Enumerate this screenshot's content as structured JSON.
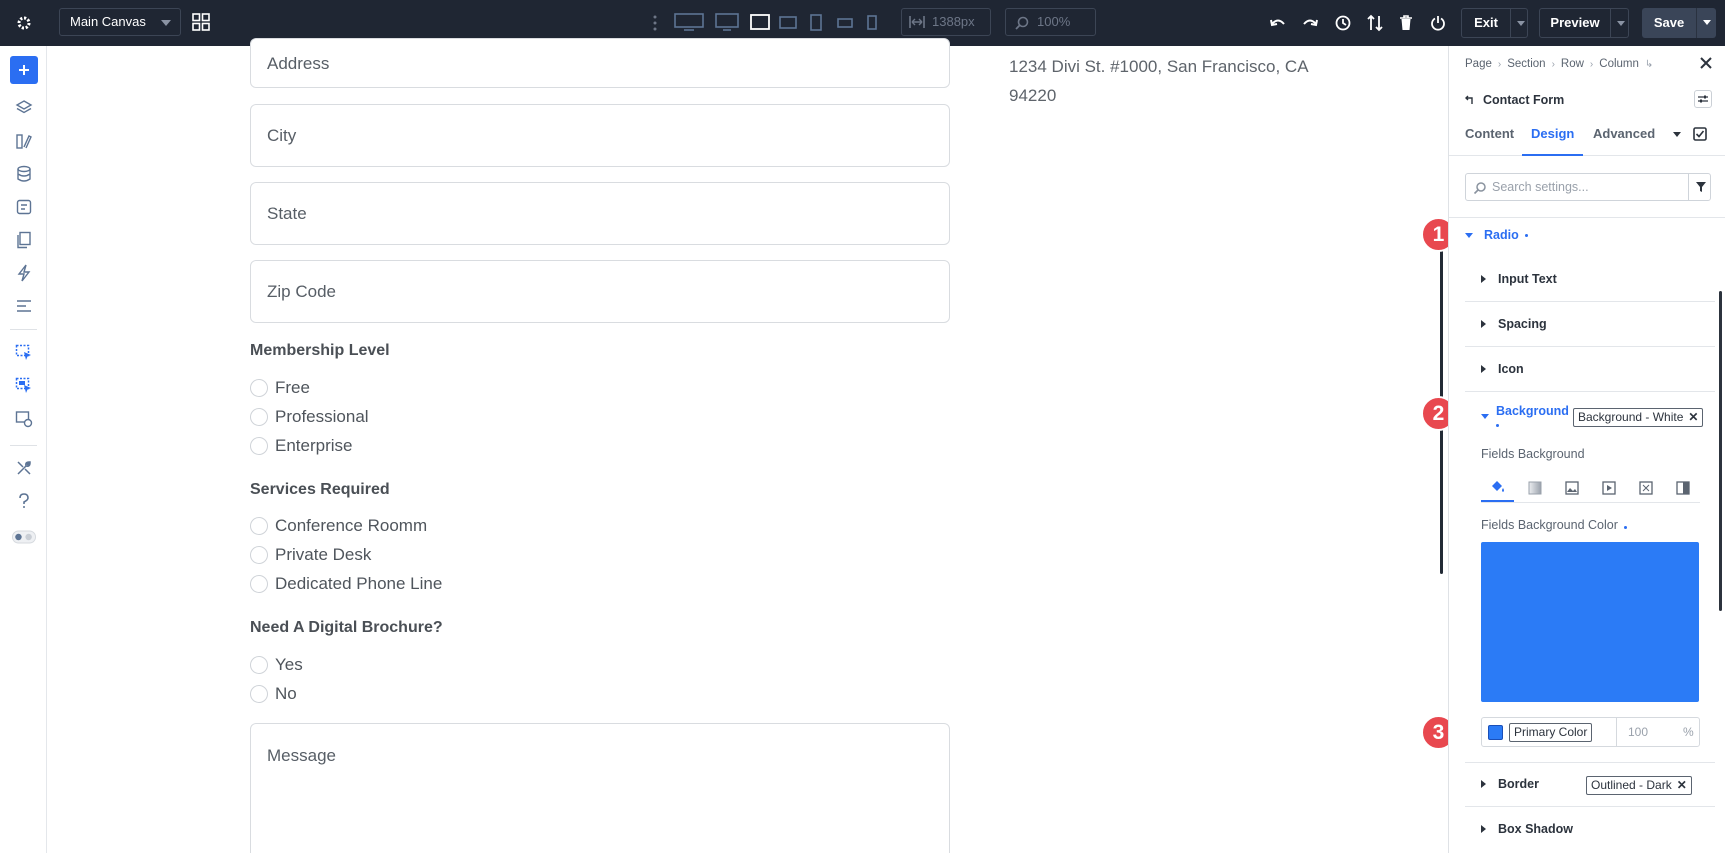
{
  "topbar": {
    "canvas_select": "Main Canvas",
    "width_value": "1388px",
    "zoom_value": "100%",
    "exit_label": "Exit",
    "preview_label": "Preview",
    "save_label": "Save"
  },
  "canvas": {
    "fields": [
      {
        "placeholder": "Address"
      },
      {
        "placeholder": "City"
      },
      {
        "placeholder": "State"
      },
      {
        "placeholder": "Zip Code"
      }
    ],
    "groups": [
      {
        "title": "Membership Level",
        "options": [
          "Free",
          "Professional",
          "Enterprise"
        ]
      },
      {
        "title": "Services Required",
        "options": [
          "Conference Roomm",
          "Private Desk",
          "Dedicated Phone Line"
        ]
      },
      {
        "title": "Need A Digital Brochure?",
        "options": [
          "Yes",
          "No"
        ]
      }
    ],
    "message_placeholder": "Message",
    "address_line1": "1234 Divi St. #1000, San Francisco, CA",
    "address_line2": "94220"
  },
  "panel": {
    "breadcrumb": [
      "Page",
      "Section",
      "Row",
      "Column"
    ],
    "element_title": "Contact Form",
    "tabs": [
      "Content",
      "Design",
      "Advanced"
    ],
    "active_tab": "Design",
    "search_placeholder": "Search settings...",
    "radio_label": "Radio",
    "sub_sections": [
      "Input Text",
      "Spacing",
      "Icon"
    ],
    "background_label": "Background",
    "background_preset": "Background - White",
    "fields_background_label": "Fields Background",
    "fields_background_color_label": "Fields Background Color",
    "color_name": "Primary Color",
    "color_value": "#2b7bf6",
    "opacity_value": "100",
    "opacity_unit": "%",
    "border_label": "Border",
    "border_preset": "Outlined - Dark",
    "box_shadow_label": "Box Shadow"
  },
  "markers": [
    "1",
    "2",
    "3"
  ]
}
